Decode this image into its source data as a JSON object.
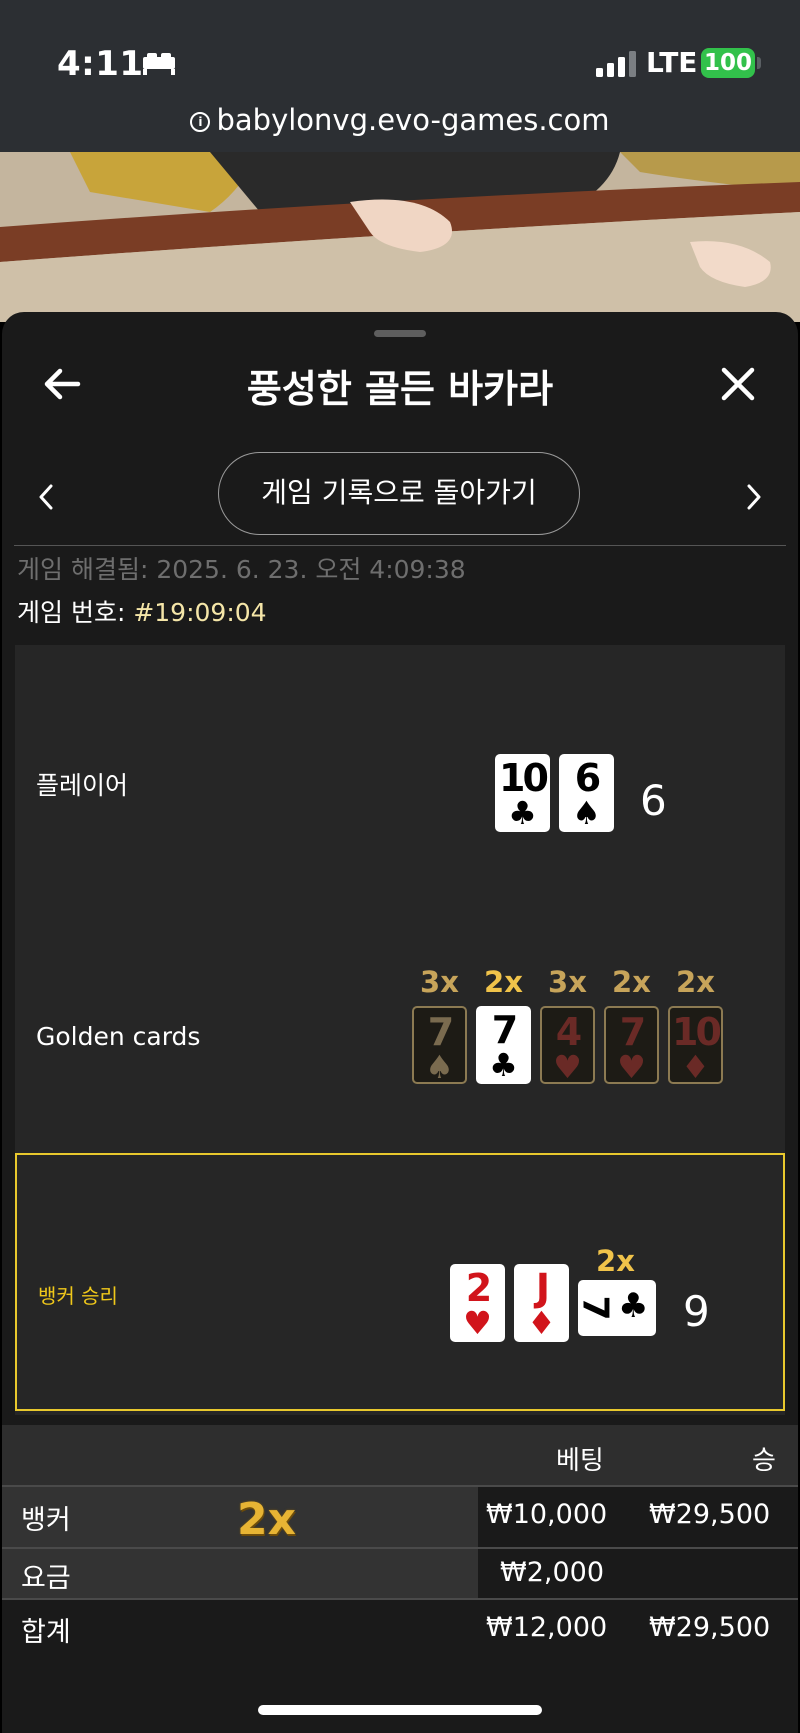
{
  "status_bar": {
    "time": "4:11",
    "network": "LTE",
    "battery": "100",
    "url": "babylonvg.evo-games.com"
  },
  "header": {
    "title": "풍성한 골든 바카라",
    "back_icon": "arrow-left-icon",
    "close_icon": "close-icon"
  },
  "nav": {
    "back_to_history": "게임 기록으로 돌아가기",
    "prev_icon": "chevron-left-icon",
    "next_icon": "chevron-right-icon"
  },
  "game": {
    "resolved_label": "게임 해결됨: 2025. 6. 23. 오전 4:09:38",
    "number_label": "게임 번호: ",
    "number": "#19:09:04"
  },
  "player": {
    "label": "플레이어",
    "cards": [
      {
        "rank": "10",
        "suit": "♣",
        "color": "black"
      },
      {
        "rank": "6",
        "suit": "♠",
        "color": "black"
      }
    ],
    "score": "6"
  },
  "golden": {
    "label": "Golden cards",
    "cards": [
      {
        "mult": "3x",
        "rank": "7",
        "suit": "♠",
        "color": "black",
        "active": false
      },
      {
        "mult": "2x",
        "rank": "7",
        "suit": "♣",
        "color": "black",
        "active": true
      },
      {
        "mult": "3x",
        "rank": "4",
        "suit": "♥",
        "color": "red",
        "active": false
      },
      {
        "mult": "2x",
        "rank": "7",
        "suit": "♥",
        "color": "red",
        "active": false
      },
      {
        "mult": "2x",
        "rank": "10",
        "suit": "♦",
        "color": "red",
        "active": false
      }
    ]
  },
  "banker": {
    "label": "뱅커 승리",
    "cards": [
      {
        "rank": "2",
        "suit": "♥",
        "color": "red"
      },
      {
        "rank": "J",
        "suit": "♦",
        "color": "red"
      }
    ],
    "side_card": {
      "rank": "7",
      "suit": "♣",
      "mult": "2x"
    },
    "score": "9"
  },
  "table": {
    "headers": {
      "bet": "베팅",
      "win": "승"
    },
    "rows": [
      {
        "label": "뱅커",
        "badge": "2x",
        "bet": "₩10,000",
        "win": "₩29,500"
      },
      {
        "label": "요금",
        "bet": "₩2,000",
        "win": ""
      }
    ],
    "total": {
      "label": "합계",
      "bet": "₩12,000",
      "win": "₩29,500"
    }
  },
  "colors": {
    "accent_gold": "#f0c81a",
    "win_border": "#e8c82d",
    "panel_bg": "#1a1a1a",
    "battery_green": "#32c14b"
  }
}
